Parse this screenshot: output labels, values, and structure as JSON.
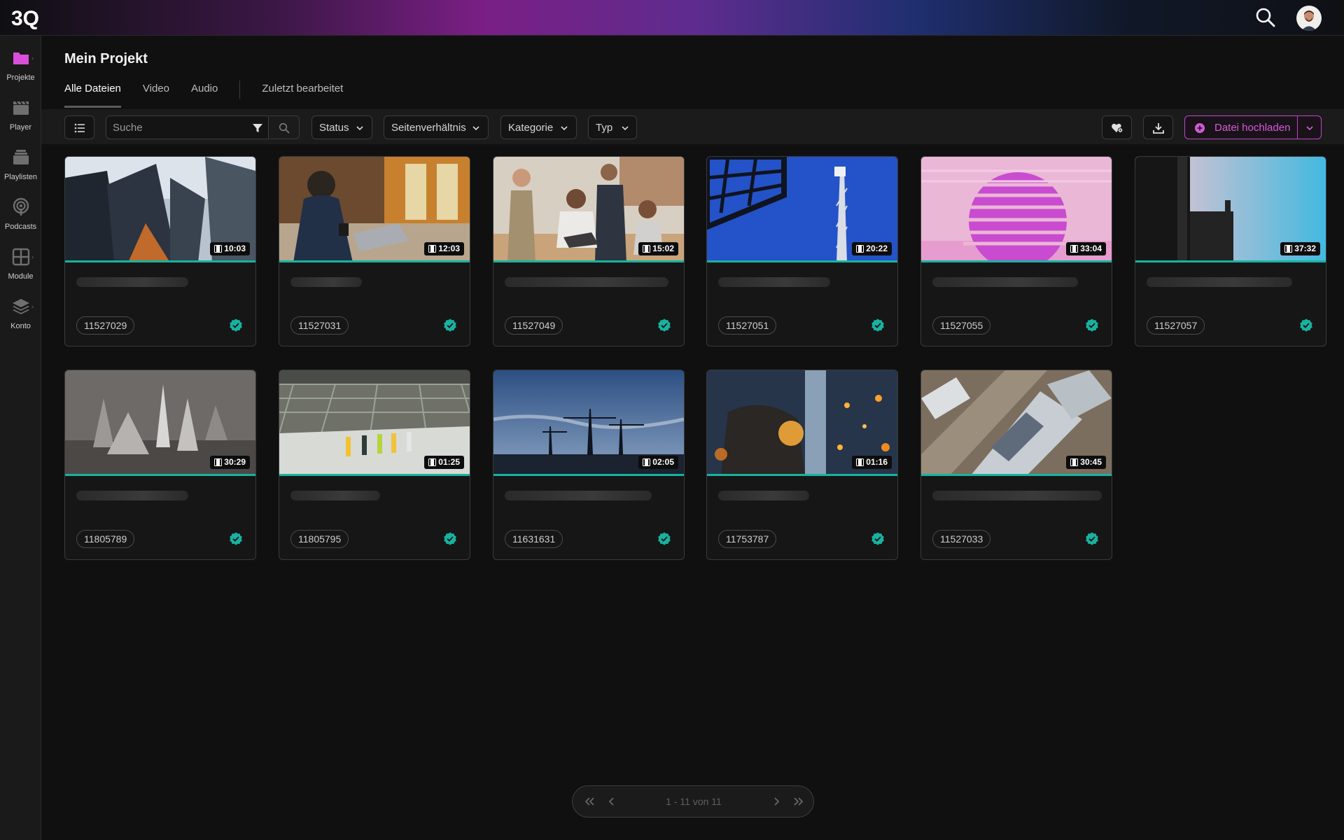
{
  "app": {
    "logo_text": "3Q"
  },
  "header": {
    "search_icon": "search-icon",
    "avatar": "user-avatar"
  },
  "sidebar": {
    "items": [
      {
        "label": "Projekte",
        "icon": "folder-icon",
        "active": true
      },
      {
        "label": "Player",
        "icon": "clapperboard-icon"
      },
      {
        "label": "Playlisten",
        "icon": "stack-icon"
      },
      {
        "label": "Podcasts",
        "icon": "podcast-icon"
      },
      {
        "label": "Module",
        "icon": "grid-icon"
      },
      {
        "label": "Konto",
        "icon": "layers-icon"
      }
    ]
  },
  "page": {
    "title": "Mein Projekt"
  },
  "tabs": [
    {
      "label": "Alle Dateien",
      "active": true
    },
    {
      "label": "Video"
    },
    {
      "label": "Audio"
    },
    {
      "label": "Zuletzt bearbeitet"
    }
  ],
  "toolbar": {
    "search_placeholder": "Suche",
    "filters": [
      "Status",
      "Seitenverhältnis",
      "Kategorie",
      "Typ"
    ],
    "upload_label": "Datei hochladen"
  },
  "files": [
    {
      "id": "11527029",
      "duration": "10:03",
      "status": "ready"
    },
    {
      "id": "11527031",
      "duration": "12:03",
      "status": "ready"
    },
    {
      "id": "11527049",
      "duration": "15:02",
      "status": "ready"
    },
    {
      "id": "11527051",
      "duration": "20:22",
      "status": "ready"
    },
    {
      "id": "11527055",
      "duration": "33:04",
      "status": "ready"
    },
    {
      "id": "11527057",
      "duration": "37:32",
      "status": "ready"
    },
    {
      "id": "11805789",
      "duration": "30:29",
      "status": "ready"
    },
    {
      "id": "11805795",
      "duration": "01:25",
      "status": "ready"
    },
    {
      "id": "11631631",
      "duration": "02:05",
      "status": "ready"
    },
    {
      "id": "11753787",
      "duration": "01:16",
      "status": "ready"
    },
    {
      "id": "11527033",
      "duration": "30:45",
      "status": "ready"
    }
  ],
  "pagination": {
    "text": "1 - 11 von 11"
  },
  "colors": {
    "accent": "#c045c9",
    "success": "#16b3a0",
    "background": "#101010"
  }
}
